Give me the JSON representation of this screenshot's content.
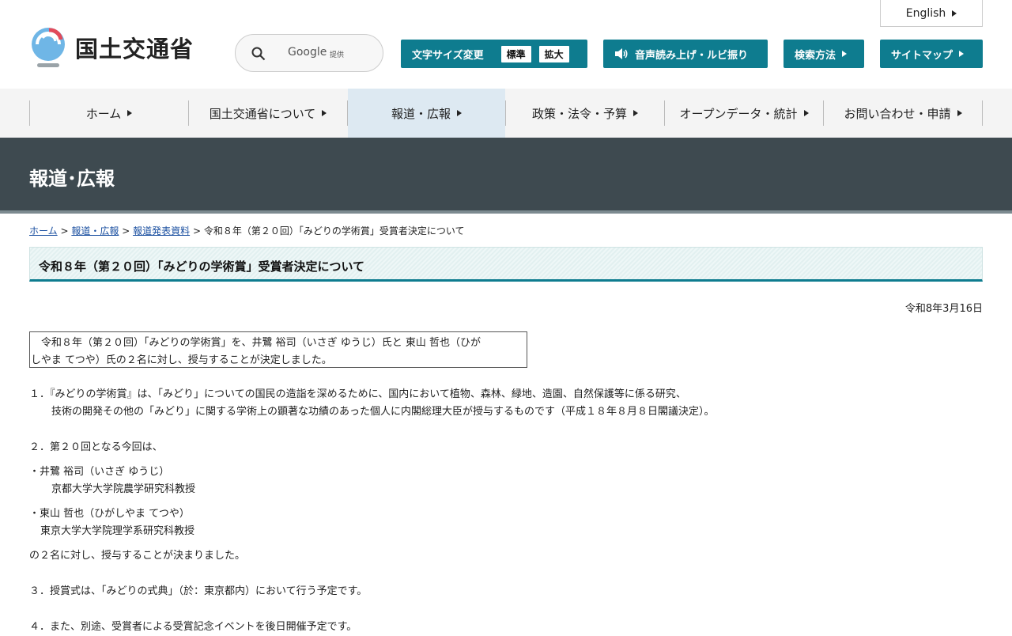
{
  "header": {
    "logo_text": "国土交通省",
    "search": {
      "google": "Google",
      "provided": "提供"
    },
    "font_size": {
      "label": "文字サイズ変更",
      "standard": "標準",
      "large": "拡大"
    },
    "voice_label": "音声読み上げ・ルビ振り",
    "search_method_label": "検索方法",
    "sitemap_label": "サイトマップ",
    "english_label": "English",
    "accent_color": "#0e7c8f"
  },
  "gnav": {
    "items": [
      {
        "label": "ホーム"
      },
      {
        "label": "国土交通省について"
      },
      {
        "label": "報道・広報"
      },
      {
        "label": "政策・法令・予算"
      },
      {
        "label": "オープンデータ・統計"
      },
      {
        "label": "お問い合わせ・申請"
      }
    ]
  },
  "banner": {
    "title": "報道･広報"
  },
  "breadcrumb": {
    "home": "ホーム",
    "press": "報道・広報",
    "releases": "報道発表資料",
    "current": "令和８年（第２０回）「みどりの学術賞」受賞者決定について",
    "sep": ">"
  },
  "article": {
    "title": "令和８年（第２０回）「みどりの学術賞」受賞者決定について",
    "date": "令和8年3月16日",
    "summary_line1": "　令和８年（第２０回）「みどりの学術賞」を、井鷺 裕司（いさぎ ゆうじ）氏と 東山 哲也（ひが",
    "summary_line2": "しやま てつや）氏の２名に対し、授与することが決定しました。",
    "p1_line1": "１．『みどりの学術賞』は、「みどり」についての国民の造詣を深めるために、国内において植物、森林、緑地、造園、自然保護等に係る研究、",
    "p1_line2": "技術の開発その他の「みどり」に関する学術上の顕著な功績のあった個人に内閣総理大臣が授与するものです（平成１８年８月８日閣議決定）。",
    "p2": "２．第２０回となる今回は、",
    "person1_name": "・井鷺 裕司（いさぎ ゆうじ）",
    "person1_affil": "京都大学大学院農学研究科教授",
    "person2_name": "・東山 哲也（ひがしやま てつや）",
    "person2_affil": "東京大学大学院理学系研究科教授",
    "p2_end": "の２名に対し、授与することが決まりました。",
    "p3": "３．授賞式は、「みどりの式典」（於：東京都内）において行う予定です。",
    "p4": "４．また、別途、受賞者による受賞記念イベントを後日開催予定です。"
  }
}
